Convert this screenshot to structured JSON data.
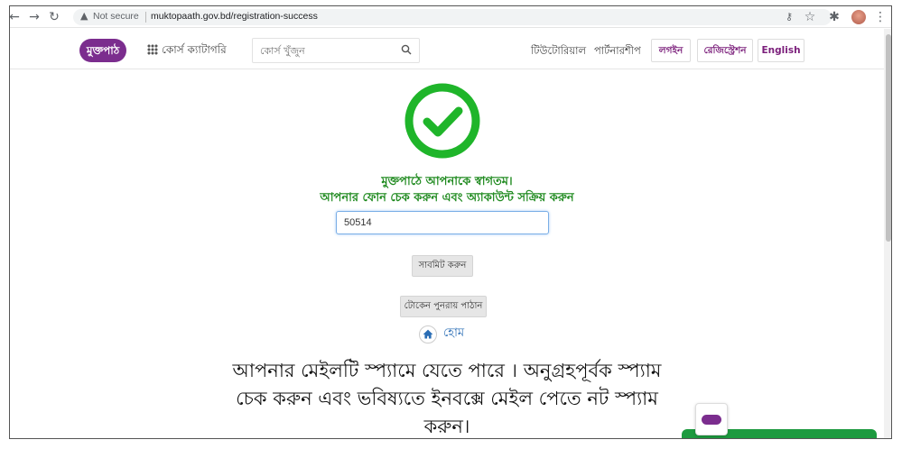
{
  "browser": {
    "security_label": "Not secure",
    "url": "muktopaath.gov.bd/registration-success"
  },
  "nav": {
    "logo_text": "মুক্তপাঠ",
    "category_label": "কোর্স ক্যাটাগরি",
    "search_placeholder": "কোর্স খুঁজুন",
    "tutorial_label": "টিউটোরিয়াল",
    "partnership_label": "পার্টনারশীপ",
    "login_label": "লগইন",
    "register_label": "রেজিস্ট্রেশন",
    "english_label": "English"
  },
  "main": {
    "welcome_text": "মুক্তপাঠে আপনাকে স্বাগতম।",
    "instruction_text": "আপনার ফোন চেক করুন এবং অ্যাকাউন্ট সক্রিয় করুন",
    "code_value": "50514",
    "submit_label": "সাবমিট করুন",
    "resend_label": "টোকেন পুনরায় পাঠান",
    "home_label": "হোম",
    "notice_lines": [
      "আপনার মেইলটি স্প্যামে যেতে পারে । অনুগ্রহপূর্বক স্প্যাম",
      "চেক করুন এবং ভবিষ্যতে ইনবক্সে মেইল পেতে নট স্প্যাম",
      "করুন।"
    ]
  },
  "colors": {
    "brand": "#7b2d8e",
    "success": "#1fb52a",
    "accent_link": "#2a6db5"
  }
}
